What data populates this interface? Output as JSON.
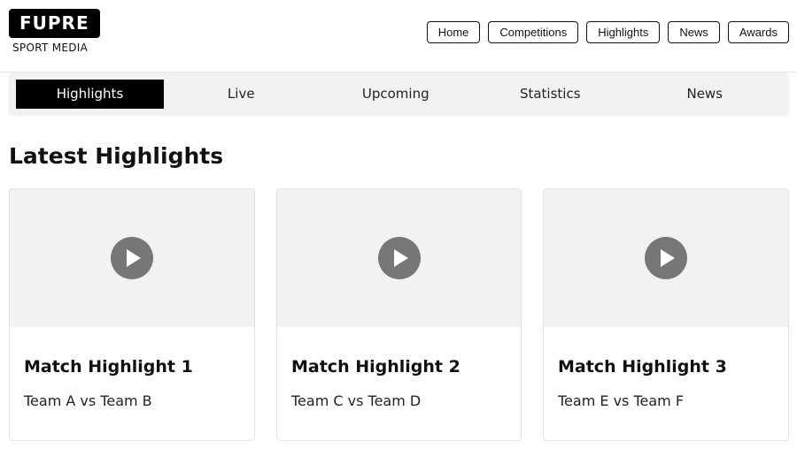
{
  "brand": {
    "name": "FUPRE",
    "tagline": "SPORT MEDIA"
  },
  "topnav": [
    "Home",
    "Competitions",
    "Highlights",
    "News",
    "Awards"
  ],
  "subnav": {
    "tabs": [
      "Highlights",
      "Live",
      "Upcoming",
      "Statistics",
      "News"
    ],
    "active": "Highlights"
  },
  "section": {
    "title": "Latest Highlights"
  },
  "cards": [
    {
      "title": "Match Highlight 1",
      "subtitle": "Team A vs Team B",
      "icon": "play-icon"
    },
    {
      "title": "Match Highlight 2",
      "subtitle": "Team C vs Team D",
      "icon": "play-icon"
    },
    {
      "title": "Match Highlight 3",
      "subtitle": "Team E vs Team F",
      "icon": "play-icon"
    }
  ],
  "colors": {
    "accent": "#000000",
    "panel": "#f2f2f2",
    "play_button": "#777777"
  }
}
